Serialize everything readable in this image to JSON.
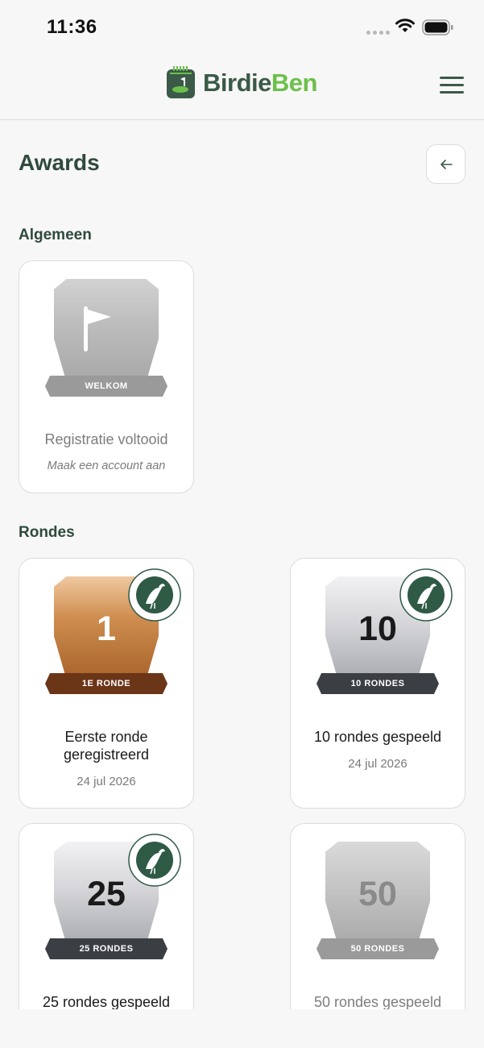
{
  "status_bar": {
    "time": "11:36"
  },
  "header": {
    "brand_part1": "Birdie",
    "brand_part2": "Ben"
  },
  "page": {
    "title": "Awards"
  },
  "sections": [
    {
      "title": "Algemeen"
    },
    {
      "title": "Rondes"
    }
  ],
  "awards": [
    {
      "badge_label": "WELKOM",
      "badge_number": "",
      "title": "Registratie voltooid",
      "subtitle": "Maak een account aan",
      "earned": false,
      "tier": "locked"
    },
    {
      "badge_label": "1E RONDE",
      "badge_number": "1",
      "title": "Eerste ronde geregistreerd",
      "subtitle": "24 jul 2026",
      "earned": true,
      "tier": "bronze"
    },
    {
      "badge_label": "10 RONDES",
      "badge_number": "10",
      "title": "10 rondes gespeeld",
      "subtitle": "24 jul 2026",
      "earned": true,
      "tier": "silver"
    },
    {
      "badge_label": "25 RONDES",
      "badge_number": "25",
      "title": "25 rondes gespeeld",
      "subtitle": "",
      "earned": true,
      "tier": "silver"
    },
    {
      "badge_label": "50 RONDES",
      "badge_number": "50",
      "title": "50 rondes gespeeld",
      "subtitle": "",
      "earned": false,
      "tier": "locked"
    }
  ],
  "icons": {
    "logo": "scorecard-logo-icon",
    "menu": "hamburger-menu-icon",
    "back": "arrow-left-icon",
    "welcome_badge": "flag-icon",
    "seal": "birdieben-seal-icon"
  },
  "colors": {
    "brand_dark": "#3b5a48",
    "brand_green": "#6cc04a",
    "bronze": "#b9773a",
    "ribbon_bronze": "#6b3518",
    "ribbon_dark": "#3b3f44",
    "locked": "#9a9a9a"
  }
}
